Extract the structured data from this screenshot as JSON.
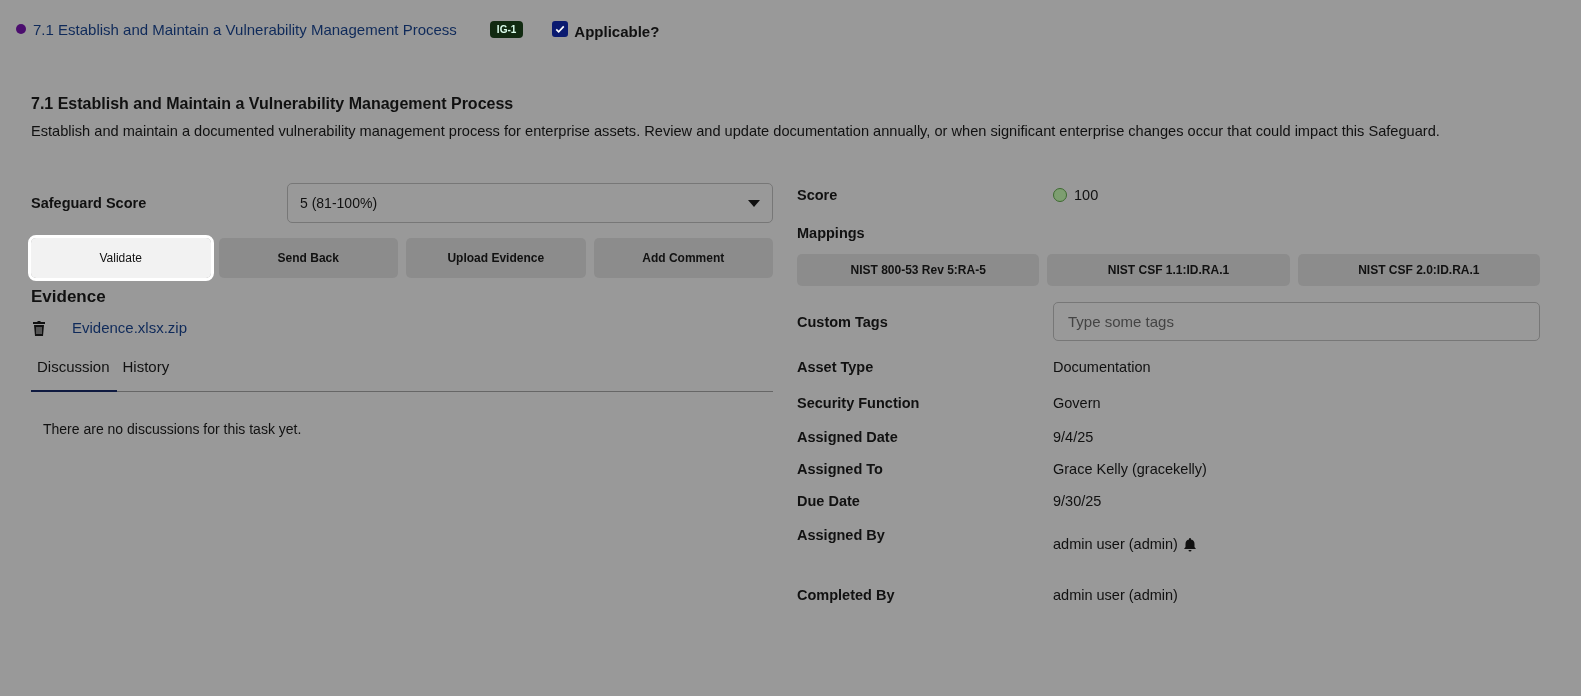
{
  "header": {
    "link": "7.1 Establish and Maintain a Vulnerability Management Process",
    "badge": "IG-1",
    "applicable": {
      "label": "Applicable?",
      "checked": true
    }
  },
  "safeguard": {
    "title": "7.1 Establish and Maintain a Vulnerability Management Process",
    "description": "Establish and maintain a documented vulnerability management process for enterprise assets. Review and update documentation annually, or when significant enterprise changes occur that could impact this Safeguard."
  },
  "safeguard_score": {
    "label": "Safeguard Score",
    "value": "5 (81-100%)"
  },
  "actions": [
    {
      "label": "Validate",
      "highlighted": true
    },
    {
      "label": "Send Back",
      "highlighted": false
    },
    {
      "label": "Upload Evidence",
      "highlighted": false
    },
    {
      "label": "Add Comment",
      "highlighted": false
    }
  ],
  "evidence": {
    "heading": "Evidence",
    "files": [
      "Evidence.xlsx.zip"
    ]
  },
  "tabs": [
    {
      "label": "Discussion",
      "selected": true
    },
    {
      "label": "History",
      "selected": false
    }
  ],
  "empty_message": "There are no discussions for this task yet.",
  "score": {
    "label": "Score",
    "value": "100"
  },
  "mappings": {
    "label": "Mappings",
    "items": [
      "NIST 800-53 Rev 5:RA-5",
      "NIST CSF 1.1:ID.RA.1",
      "NIST CSF 2.0:ID.RA.1"
    ]
  },
  "custom_tags": {
    "label": "Custom Tags",
    "placeholder": "Type some tags"
  },
  "details": [
    {
      "label": "Asset Type",
      "value": "Documentation",
      "bell": false
    },
    {
      "label": "Security Function",
      "value": "Govern",
      "bell": false
    },
    {
      "label": "Assigned Date",
      "value": "9/4/25",
      "bell": false
    },
    {
      "label": "Assigned To",
      "value": "Grace Kelly (gracekelly)",
      "bell": false
    },
    {
      "label": "Due Date",
      "value": "9/30/25",
      "bell": false
    },
    {
      "label": "Assigned By",
      "value": "admin user (admin)",
      "bell": true
    },
    {
      "label": "Completed By",
      "value": "admin user (admin)",
      "bell": false
    }
  ]
}
